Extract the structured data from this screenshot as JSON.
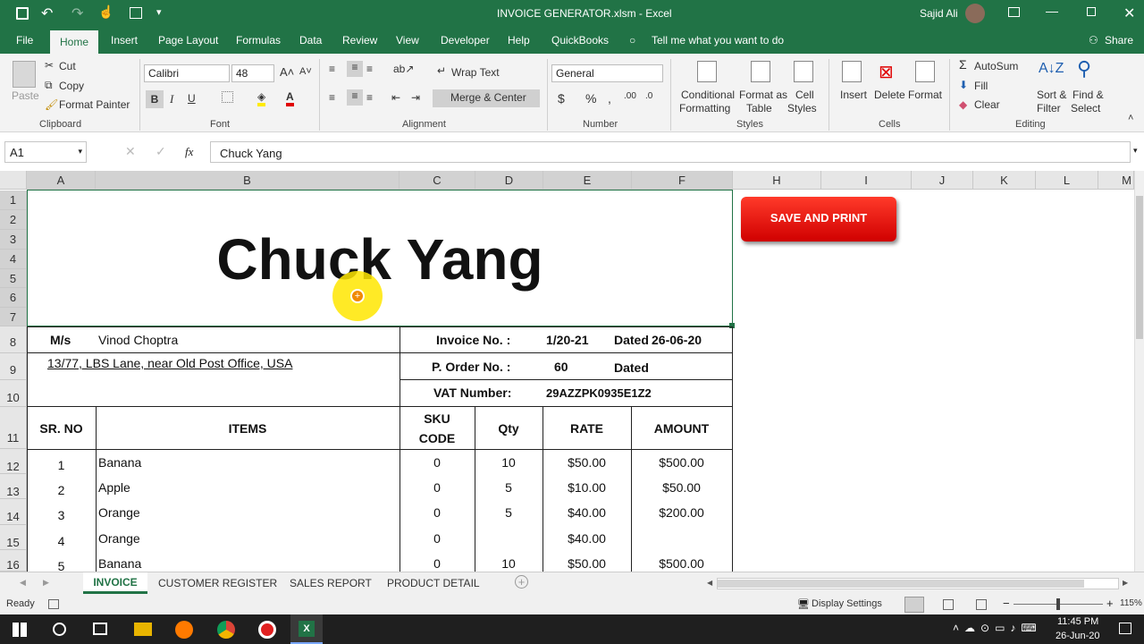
{
  "window": {
    "title": "INVOICE GENERATOR.xlsm  -  Excel",
    "user": "Sajid Ali"
  },
  "tabs": [
    "File",
    "Home",
    "Insert",
    "Page Layout",
    "Formulas",
    "Data",
    "Review",
    "View",
    "Developer",
    "Help",
    "QuickBooks"
  ],
  "tell_me": "Tell me what you want to do",
  "share": "Share",
  "ribbon": {
    "clipboard": {
      "paste": "Paste",
      "cut": "Cut",
      "copy": "Copy",
      "format_painter": "Format Painter",
      "label": "Clipboard"
    },
    "font": {
      "name": "Calibri",
      "size": "48",
      "label": "Font"
    },
    "alignment": {
      "wrap": "Wrap Text",
      "merge": "Merge & Center",
      "label": "Alignment"
    },
    "number": {
      "format": "General",
      "label": "Number"
    },
    "styles": {
      "cond1": "Conditional",
      "cond2": "Formatting",
      "fat1": "Format as",
      "fat2": "Table",
      "cs1": "Cell",
      "cs2": "Styles",
      "label": "Styles"
    },
    "cells": {
      "insert": "Insert",
      "delete": "Delete",
      "format": "Format",
      "label": "Cells"
    },
    "editing": {
      "autosum": "AutoSum",
      "fill": "Fill",
      "clear": "Clear",
      "sort1": "Sort &",
      "sort2": "Filter",
      "find1": "Find &",
      "find2": "Select",
      "label": "Editing"
    }
  },
  "formula_bar": {
    "name_box": "A1",
    "fx": "fx",
    "value": "Chuck Yang"
  },
  "columns": [
    "A",
    "B",
    "C",
    "D",
    "E",
    "F",
    "H",
    "I",
    "J",
    "K",
    "L",
    "M"
  ],
  "rows": [
    "1",
    "2",
    "3",
    "4",
    "5",
    "6",
    "7",
    "8",
    "9",
    "10",
    "11",
    "12",
    "13",
    "14",
    "15",
    "16"
  ],
  "invoice": {
    "company": "Chuck Yang",
    "ms_label": "M/s",
    "customer": "Vinod Choptra",
    "address": "13/77,  LBS Lane, near Old Post Office, USA",
    "invoice_no_label": "Invoice No. :",
    "invoice_no": "1/20-21",
    "dated_label": "Dated",
    "dated": "26-06-20",
    "po_label": "P. Order No. :",
    "po": "60",
    "po_dated_label": "Dated",
    "vat_label": "VAT Number:",
    "vat": "29AZZPK0935E1Z2",
    "headers": {
      "sr": "SR. NO",
      "items": "ITEMS",
      "sku1": "SKU",
      "sku2": "CODE",
      "qty": "Qty",
      "rate": "RATE",
      "amount": "AMOUNT"
    },
    "lines": [
      {
        "sr": "1",
        "item": "Banana",
        "sku": "0",
        "qty": "10",
        "rate": "$50.00",
        "amount": "$500.00"
      },
      {
        "sr": "2",
        "item": "Apple",
        "sku": "0",
        "qty": "5",
        "rate": "$10.00",
        "amount": "$50.00"
      },
      {
        "sr": "3",
        "item": "Orange",
        "sku": "0",
        "qty": "5",
        "rate": "$40.00",
        "amount": "$200.00"
      },
      {
        "sr": "4",
        "item": "Orange",
        "sku": "0",
        "qty": "",
        "rate": "$40.00",
        "amount": ""
      },
      {
        "sr": "5",
        "item": "Banana",
        "sku": "0",
        "qty": "10",
        "rate": "$50.00",
        "amount": "$500.00"
      }
    ]
  },
  "save_button": "SAVE AND PRINT",
  "sheet_tabs": [
    "INVOICE",
    "CUSTOMER REGISTER",
    "SALES REPORT",
    "PRODUCT DETAIL"
  ],
  "status": {
    "ready": "Ready",
    "display_settings": "Display Settings",
    "zoom": "115%"
  },
  "taskbar": {
    "time": "11:45 PM",
    "date": "26-Jun-20"
  },
  "colors": {
    "excel_green": "#217346",
    "save_red": "#e00000"
  }
}
